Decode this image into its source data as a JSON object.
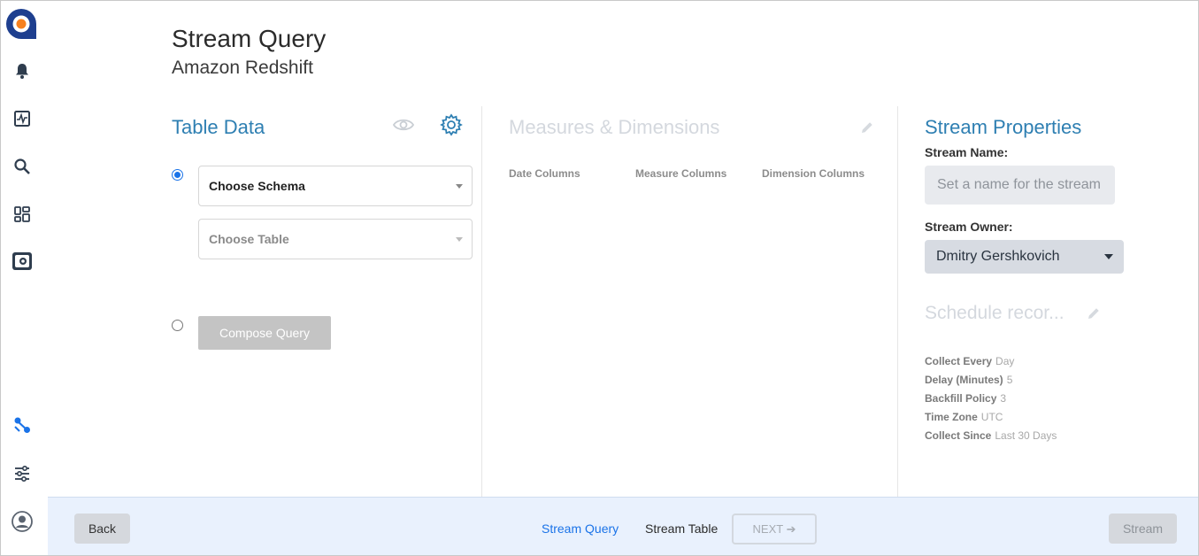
{
  "header": {
    "title": "Stream Query",
    "subtitle": "Amazon Redshift"
  },
  "sidebar": {
    "items": [
      {
        "name": "bell-icon"
      },
      {
        "name": "activity-icon"
      },
      {
        "name": "search-icon"
      },
      {
        "name": "dashboards-icon"
      },
      {
        "name": "streams-icon"
      },
      {
        "name": "link-icon"
      },
      {
        "name": "sliders-icon"
      },
      {
        "name": "user-icon"
      }
    ]
  },
  "table_data": {
    "title": "Table Data",
    "schema_select": "Choose Schema",
    "table_select": "Choose Table",
    "compose_label": "Compose Query"
  },
  "measures": {
    "title": "Measures & Dimensions",
    "columns": [
      "Date Columns",
      "Measure Columns",
      "Dimension Columns"
    ]
  },
  "stream_properties": {
    "title": "Stream Properties",
    "name_label": "Stream Name:",
    "name_placeholder": "Set a name for the stream",
    "owner_label": "Stream Owner:",
    "owner_value": "Dmitry Gershkovich",
    "schedule_title": "Schedule recor...",
    "schedule": [
      {
        "key": "Collect Every",
        "value": "Day"
      },
      {
        "key": "Delay (Minutes)",
        "value": "5"
      },
      {
        "key": "Backfill Policy",
        "value": "3"
      },
      {
        "key": "Time Zone",
        "value": "UTC"
      },
      {
        "key": "Collect Since",
        "value": "Last 30 Days"
      }
    ]
  },
  "footer": {
    "back_label": "Back",
    "step_query": "Stream Query",
    "step_table": "Stream Table",
    "next_label": "NEXT ➔",
    "stream_label": "Stream"
  },
  "colors": {
    "accent": "#2e7fb2",
    "link": "#1a73e8",
    "footer_bg": "#e9f1fd"
  }
}
